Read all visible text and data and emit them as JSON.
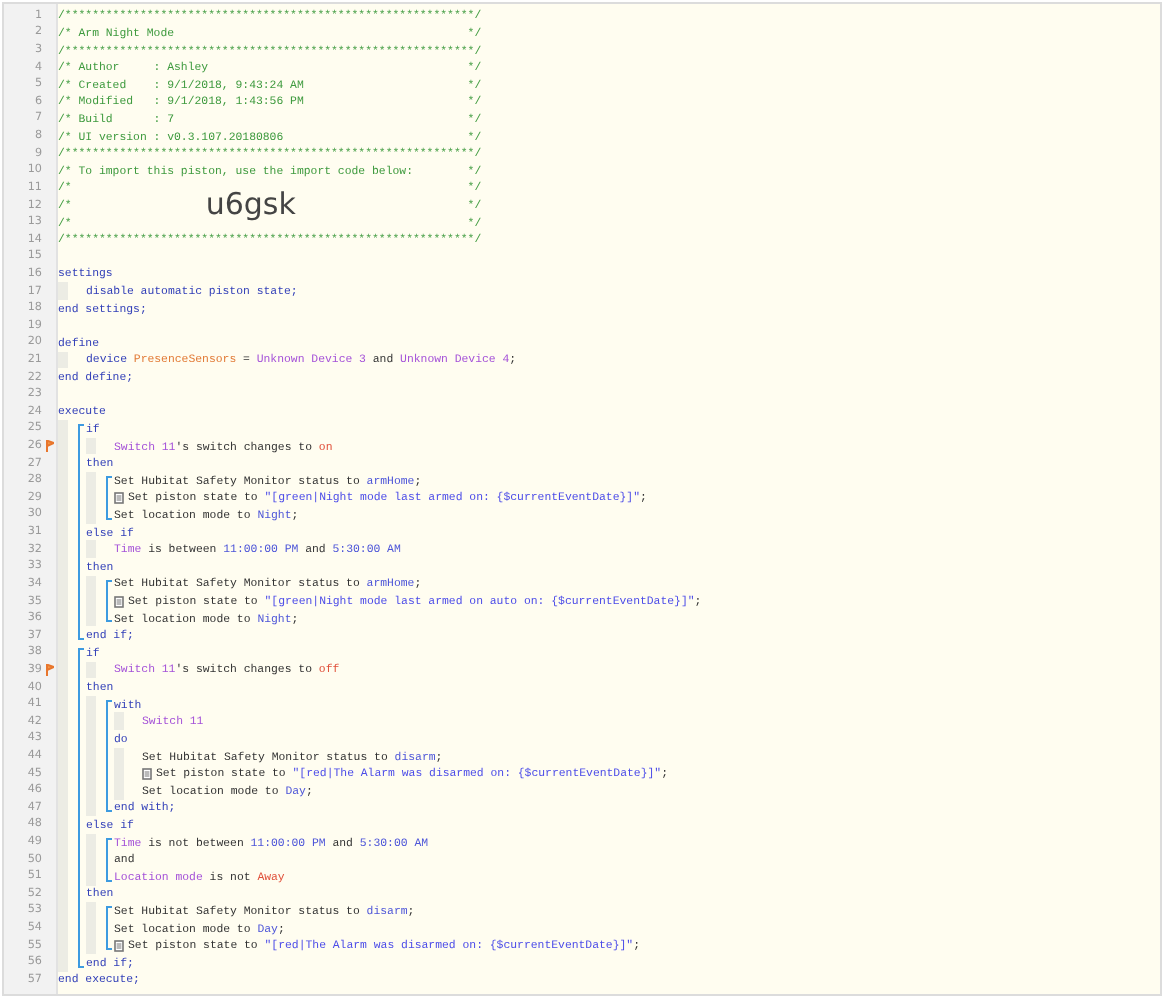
{
  "lines": [
    {
      "kind": "line",
      "number": "1",
      "flagged": false,
      "segments": [
        {
          "kind": "comment",
          "text": "/************************************************************/"
        }
      ]
    },
    {
      "kind": "line",
      "number": "2",
      "flagged": false,
      "segments": [
        {
          "kind": "comment",
          "text": "/* Arm Night Mode"
        },
        {
          "kind": "comment_close",
          "text": "*/"
        }
      ]
    },
    {
      "kind": "line",
      "number": "3",
      "flagged": false,
      "segments": [
        {
          "kind": "comment",
          "text": "/************************************************************/"
        }
      ]
    },
    {
      "kind": "line",
      "number": "4",
      "flagged": false,
      "segments": [
        {
          "kind": "comment",
          "text": "/* Author     : Ashley"
        },
        {
          "kind": "comment_close",
          "text": "*/"
        }
      ]
    },
    {
      "kind": "line",
      "number": "5",
      "flagged": false,
      "segments": [
        {
          "kind": "comment",
          "text": "/* Created    : 9/1/2018, 9:43:24 AM"
        },
        {
          "kind": "comment_close",
          "text": "*/"
        }
      ]
    },
    {
      "kind": "line",
      "number": "6",
      "flagged": false,
      "segments": [
        {
          "kind": "comment",
          "text": "/* Modified   : 9/1/2018, 1:43:56 PM"
        },
        {
          "kind": "comment_close",
          "text": "*/"
        }
      ]
    },
    {
      "kind": "line",
      "number": "7",
      "flagged": false,
      "segments": [
        {
          "kind": "comment",
          "text": "/* Build      : 7"
        },
        {
          "kind": "comment_close",
          "text": "*/"
        }
      ]
    },
    {
      "kind": "line",
      "number": "8",
      "flagged": false,
      "segments": [
        {
          "kind": "comment",
          "text": "/* UI version : v0.3.107.20180806"
        },
        {
          "kind": "comment_close",
          "text": "*/"
        }
      ]
    },
    {
      "kind": "line",
      "number": "9",
      "flagged": false,
      "segments": [
        {
          "kind": "comment",
          "text": "/************************************************************/"
        }
      ]
    },
    {
      "kind": "line",
      "number": "10",
      "flagged": false,
      "segments": [
        {
          "kind": "comment",
          "text": "/* To import this piston, use the import code below:"
        },
        {
          "kind": "comment_close",
          "text": "*/"
        }
      ]
    },
    {
      "kind": "line",
      "number": "11",
      "flagged": false,
      "segments": [
        {
          "kind": "comment",
          "text": "/*"
        },
        {
          "kind": "comment_close",
          "text": "*/"
        }
      ]
    },
    {
      "kind": "line",
      "number": "12",
      "flagged": false,
      "segments": [
        {
          "kind": "comment",
          "text": "/*"
        },
        {
          "kind": "import_code",
          "text": "u6gsk"
        },
        {
          "kind": "comment_close",
          "text": "*/"
        }
      ]
    },
    {
      "kind": "line",
      "number": "13",
      "flagged": false,
      "segments": [
        {
          "kind": "comment",
          "text": "/*"
        },
        {
          "kind": "comment_close",
          "text": "*/"
        }
      ]
    },
    {
      "kind": "line",
      "number": "14",
      "flagged": false,
      "segments": [
        {
          "kind": "comment",
          "text": "/************************************************************/"
        }
      ]
    },
    {
      "kind": "line",
      "number": "15",
      "flagged": false
    },
    {
      "kind": "line",
      "number": "16",
      "flagged": false,
      "segments": [
        {
          "kind": "keyword",
          "text": "settings"
        }
      ]
    },
    {
      "kind": "block",
      "bracket": false,
      "children": [
        {
          "kind": "line",
          "number": "17",
          "flagged": false,
          "segments": [
            {
              "kind": "keyword",
              "text": "disable automatic piston state;"
            }
          ]
        }
      ]
    },
    {
      "kind": "line",
      "number": "18",
      "flagged": false,
      "segments": [
        {
          "kind": "keyword",
          "text": "end settings;"
        }
      ]
    },
    {
      "kind": "line",
      "number": "19",
      "flagged": false
    },
    {
      "kind": "line",
      "number": "20",
      "flagged": false,
      "segments": [
        {
          "kind": "keyword",
          "text": "define"
        }
      ]
    },
    {
      "kind": "block",
      "bracket": false,
      "children": [
        {
          "kind": "line",
          "number": "21",
          "flagged": false,
          "segments": [
            {
              "kind": "keyword",
              "text": "device "
            },
            {
              "kind": "variable",
              "text": "PresenceSensors"
            },
            {
              "kind": "plain",
              "text": " = "
            },
            {
              "kind": "device",
              "text": "Unknown Device 3"
            },
            {
              "kind": "plain",
              "text": " and "
            },
            {
              "kind": "device",
              "text": "Unknown Device 4"
            },
            {
              "kind": "plain",
              "text": ";"
            }
          ]
        }
      ]
    },
    {
      "kind": "line",
      "number": "22",
      "flagged": false,
      "segments": [
        {
          "kind": "keyword",
          "text": "end define;"
        }
      ]
    },
    {
      "kind": "line",
      "number": "23",
      "flagged": false
    },
    {
      "kind": "line",
      "number": "24",
      "flagged": false,
      "segments": [
        {
          "kind": "keyword",
          "text": "execute"
        }
      ]
    },
    {
      "kind": "block",
      "bracket": true,
      "children": [
        {
          "kind": "line",
          "number": "25",
          "flagged": false,
          "segments": [
            {
              "kind": "keyword",
              "text": "if"
            }
          ]
        },
        {
          "kind": "block",
          "bracket": false,
          "children": [
            {
              "kind": "line",
              "number": "26",
              "flagged": true,
              "segments": [
                {
                  "kind": "device",
                  "text": "Switch 11"
                },
                {
                  "kind": "plain",
                  "text": "'s switch changes to "
                },
                {
                  "kind": "value_red",
                  "text": "on"
                }
              ]
            }
          ]
        },
        {
          "kind": "line",
          "number": "27",
          "flagged": false,
          "segments": [
            {
              "kind": "keyword",
              "text": "then"
            }
          ]
        },
        {
          "kind": "block",
          "bracket": true,
          "children": [
            {
              "kind": "line",
              "number": "28",
              "flagged": false,
              "segments": [
                {
                  "kind": "plain",
                  "text": "Set Hubitat Safety Monitor status to "
                },
                {
                  "kind": "value",
                  "text": "armHome"
                },
                {
                  "kind": "plain",
                  "text": ";"
                }
              ]
            },
            {
              "kind": "note_line",
              "number": "29",
              "flagged": false,
              "segments": [
                {
                  "kind": "plain",
                  "text": "Set piston state to "
                },
                {
                  "kind": "string",
                  "text": "\"[green|Night mode last armed on: {$currentEventDate}]\""
                },
                {
                  "kind": "plain",
                  "text": ";"
                }
              ]
            },
            {
              "kind": "line",
              "number": "30",
              "flagged": false,
              "segments": [
                {
                  "kind": "plain",
                  "text": "Set location mode to "
                },
                {
                  "kind": "value",
                  "text": "Night"
                },
                {
                  "kind": "plain",
                  "text": ";"
                }
              ]
            }
          ]
        },
        {
          "kind": "line",
          "number": "31",
          "flagged": false,
          "segments": [
            {
              "kind": "keyword",
              "text": "else if"
            }
          ]
        },
        {
          "kind": "block",
          "bracket": false,
          "children": [
            {
              "kind": "line",
              "number": "32",
              "flagged": false,
              "segments": [
                {
                  "kind": "device",
                  "text": "Time"
                },
                {
                  "kind": "plain",
                  "text": " is between "
                },
                {
                  "kind": "value",
                  "text": "11:00:00 PM"
                },
                {
                  "kind": "plain",
                  "text": " and "
                },
                {
                  "kind": "value",
                  "text": "5:30:00 AM"
                }
              ]
            }
          ]
        },
        {
          "kind": "line",
          "number": "33",
          "flagged": false,
          "segments": [
            {
              "kind": "keyword",
              "text": "then"
            }
          ]
        },
        {
          "kind": "block",
          "bracket": true,
          "children": [
            {
              "kind": "line",
              "number": "34",
              "flagged": false,
              "segments": [
                {
                  "kind": "plain",
                  "text": "Set Hubitat Safety Monitor status to "
                },
                {
                  "kind": "value",
                  "text": "armHome"
                },
                {
                  "kind": "plain",
                  "text": ";"
                }
              ]
            },
            {
              "kind": "note_line",
              "number": "35",
              "flagged": false,
              "segments": [
                {
                  "kind": "plain",
                  "text": "Set piston state to "
                },
                {
                  "kind": "string",
                  "text": "\"[green|Night mode last armed on auto on: {$currentEventDate}]\""
                },
                {
                  "kind": "plain",
                  "text": ";"
                }
              ]
            },
            {
              "kind": "line",
              "number": "36",
              "flagged": false,
              "segments": [
                {
                  "kind": "plain",
                  "text": "Set location mode to "
                },
                {
                  "kind": "value",
                  "text": "Night"
                },
                {
                  "kind": "plain",
                  "text": ";"
                }
              ]
            }
          ]
        },
        {
          "kind": "line",
          "number": "37",
          "flagged": false,
          "segments": [
            {
              "kind": "keyword",
              "text": "end if;"
            }
          ]
        }
      ]
    },
    {
      "kind": "block",
      "bracket": true,
      "children": [
        {
          "kind": "line",
          "number": "38",
          "flagged": false,
          "segments": [
            {
              "kind": "keyword",
              "text": "if"
            }
          ]
        },
        {
          "kind": "block",
          "bracket": false,
          "children": [
            {
              "kind": "line",
              "number": "39",
              "flagged": true,
              "segments": [
                {
                  "kind": "device",
                  "text": "Switch 11"
                },
                {
                  "kind": "plain",
                  "text": "'s switch changes to "
                },
                {
                  "kind": "value_red",
                  "text": "off"
                }
              ]
            }
          ]
        },
        {
          "kind": "line",
          "number": "40",
          "flagged": false,
          "segments": [
            {
              "kind": "keyword",
              "text": "then"
            }
          ]
        },
        {
          "kind": "block",
          "bracket": true,
          "children": [
            {
              "kind": "line",
              "number": "41",
              "flagged": false,
              "segments": [
                {
                  "kind": "keyword",
                  "text": "with"
                }
              ]
            },
            {
              "kind": "block",
              "bracket": false,
              "children": [
                {
                  "kind": "line",
                  "number": "42",
                  "flagged": false,
                  "segments": [
                    {
                      "kind": "device",
                      "text": "Switch 11"
                    }
                  ]
                }
              ]
            },
            {
              "kind": "line",
              "number": "43",
              "flagged": false,
              "segments": [
                {
                  "kind": "keyword",
                  "text": "do"
                }
              ]
            },
            {
              "kind": "block",
              "bracket": false,
              "children": [
                {
                  "kind": "line",
                  "number": "44",
                  "flagged": false,
                  "segments": [
                    {
                      "kind": "plain",
                      "text": "Set Hubitat Safety Monitor status to "
                    },
                    {
                      "kind": "value",
                      "text": "disarm"
                    },
                    {
                      "kind": "plain",
                      "text": ";"
                    }
                  ]
                },
                {
                  "kind": "note_line",
                  "number": "45",
                  "flagged": false,
                  "segments": [
                    {
                      "kind": "plain",
                      "text": "Set piston state to "
                    },
                    {
                      "kind": "string",
                      "text": "\"[red|The Alarm was disarmed on: {$currentEventDate}]\""
                    },
                    {
                      "kind": "plain",
                      "text": ";"
                    }
                  ]
                },
                {
                  "kind": "line",
                  "number": "46",
                  "flagged": false,
                  "segments": [
                    {
                      "kind": "plain",
                      "text": "Set location mode to "
                    },
                    {
                      "kind": "value",
                      "text": "Day"
                    },
                    {
                      "kind": "plain",
                      "text": ";"
                    }
                  ]
                }
              ]
            },
            {
              "kind": "line",
              "number": "47",
              "flagged": false,
              "segments": [
                {
                  "kind": "keyword",
                  "text": "end with;"
                }
              ]
            }
          ]
        },
        {
          "kind": "line",
          "number": "48",
          "flagged": false,
          "segments": [
            {
              "kind": "keyword",
              "text": "else if"
            }
          ]
        },
        {
          "kind": "block",
          "bracket": true,
          "children": [
            {
              "kind": "line",
              "number": "49",
              "flagged": false,
              "segments": [
                {
                  "kind": "device",
                  "text": "Time"
                },
                {
                  "kind": "plain",
                  "text": " is not between "
                },
                {
                  "kind": "value",
                  "text": "11:00:00 PM"
                },
                {
                  "kind": "plain",
                  "text": " and "
                },
                {
                  "kind": "value",
                  "text": "5:30:00 AM"
                }
              ]
            },
            {
              "kind": "line",
              "number": "50",
              "flagged": false,
              "segments": [
                {
                  "kind": "plain",
                  "text": "and"
                }
              ]
            },
            {
              "kind": "line",
              "number": "51",
              "flagged": false,
              "segments": [
                {
                  "kind": "device",
                  "text": "Location mode"
                },
                {
                  "kind": "plain",
                  "text": " is not "
                },
                {
                  "kind": "value_red",
                  "text": "Away"
                }
              ]
            }
          ]
        },
        {
          "kind": "line",
          "number": "52",
          "flagged": false,
          "segments": [
            {
              "kind": "keyword",
              "text": "then"
            }
          ]
        },
        {
          "kind": "block",
          "bracket": true,
          "children": [
            {
              "kind": "line",
              "number": "53",
              "flagged": false,
              "segments": [
                {
                  "kind": "plain",
                  "text": "Set Hubitat Safety Monitor status to "
                },
                {
                  "kind": "value",
                  "text": "disarm"
                },
                {
                  "kind": "plain",
                  "text": ";"
                }
              ]
            },
            {
              "kind": "line",
              "number": "54",
              "flagged": false,
              "segments": [
                {
                  "kind": "plain",
                  "text": "Set location mode to "
                },
                {
                  "kind": "value",
                  "text": "Day"
                },
                {
                  "kind": "plain",
                  "text": ";"
                }
              ]
            },
            {
              "kind": "note_line",
              "number": "55",
              "flagged": false,
              "segments": [
                {
                  "kind": "plain",
                  "text": "Set piston state to "
                },
                {
                  "kind": "string",
                  "text": "\"[red|The Alarm was disarmed on: {$currentEventDate}]\""
                },
                {
                  "kind": "plain",
                  "text": ";"
                }
              ]
            }
          ]
        },
        {
          "kind": "line",
          "number": "56",
          "flagged": false,
          "segments": [
            {
              "kind": "keyword",
              "text": "end if;"
            }
          ]
        }
      ]
    },
    {
      "kind": "line",
      "number": "57",
      "flagged": false,
      "segments": [
        {
          "kind": "keyword",
          "text": "end execute;"
        }
      ]
    }
  ]
}
